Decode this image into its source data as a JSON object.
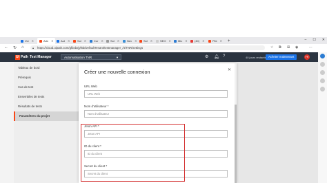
{
  "browser": {
    "tabs": [
      {
        "label": "Voi",
        "color": "#1a73e8"
      },
      {
        "label": "Adn",
        "color": "#fa4616",
        "active": true
      },
      {
        "label": "Aut",
        "color": "#1a73e8"
      },
      {
        "label": "Sol",
        "color": "#fa4616"
      },
      {
        "label": "Cor",
        "color": "#2b7cd3"
      },
      {
        "label": "Sol",
        "color": "#999999"
      },
      {
        "label": "Nev",
        "color": "#3a8fd6"
      },
      {
        "label": "Sol",
        "color": "#fa4616"
      },
      {
        "label": "SEO",
        "color": "#cccccc"
      },
      {
        "label": "Mic",
        "color": "#2b7cd3"
      },
      {
        "label": "(40)",
        "color": "#e53935"
      },
      {
        "label": "Pile",
        "color": "#fa4616"
      }
    ],
    "url": "https://cloud.uipath.com/gfbxbxjyf6b/DefaultTenant/testmanager_/4/TNR/settings"
  },
  "app": {
    "logo_ui": "Ui",
    "logo_path": "Path",
    "name": "Test Manager",
    "project": "Automatisation TNR",
    "trial_text": "40 jours restants",
    "upgrade_label": "Acheter maintenant",
    "avatar_initials": "FR",
    "brand_color": "#fa4616"
  },
  "sidebar": {
    "items": [
      {
        "label": "Tableau de bord"
      },
      {
        "label": "Prérequis"
      },
      {
        "label": "Cas de test"
      },
      {
        "label": "Ensembles de tests"
      },
      {
        "label": "Résultats de tests"
      },
      {
        "label": "Paramètres du projet",
        "selected": true
      }
    ]
  },
  "modal": {
    "title": "Créer une nouvelle connexion",
    "fields": [
      {
        "label": "URL Web",
        "placeholder": "URL Web"
      },
      {
        "label": "Nom d'utilisateur *",
        "placeholder": "Nom d'utilisateur"
      },
      {
        "label": "Jeton API *",
        "placeholder": "Jeton API"
      },
      {
        "label": "ID du client *",
        "placeholder": "ID du client"
      },
      {
        "label": "Secret du client *",
        "placeholder": "Secret du client"
      }
    ],
    "highlight_color": "#d32f2f"
  }
}
